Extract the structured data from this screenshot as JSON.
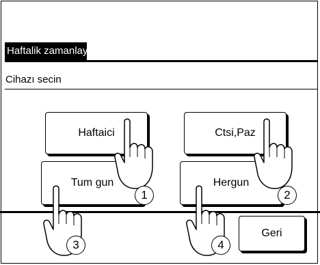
{
  "screen": {
    "title": "Haftalik zamanlayici",
    "prompt": "Cihazı secin"
  },
  "buttons": {
    "weekdays": "Haftaici",
    "weekend": "Ctsi,Paz",
    "all_days": "Tum gun",
    "everyday": "Hergun",
    "back": "Geri"
  },
  "callouts": {
    "one": "1",
    "two": "2",
    "three": "3",
    "four": "4"
  },
  "icons": {
    "pointer": "hand-pointer-icon"
  }
}
